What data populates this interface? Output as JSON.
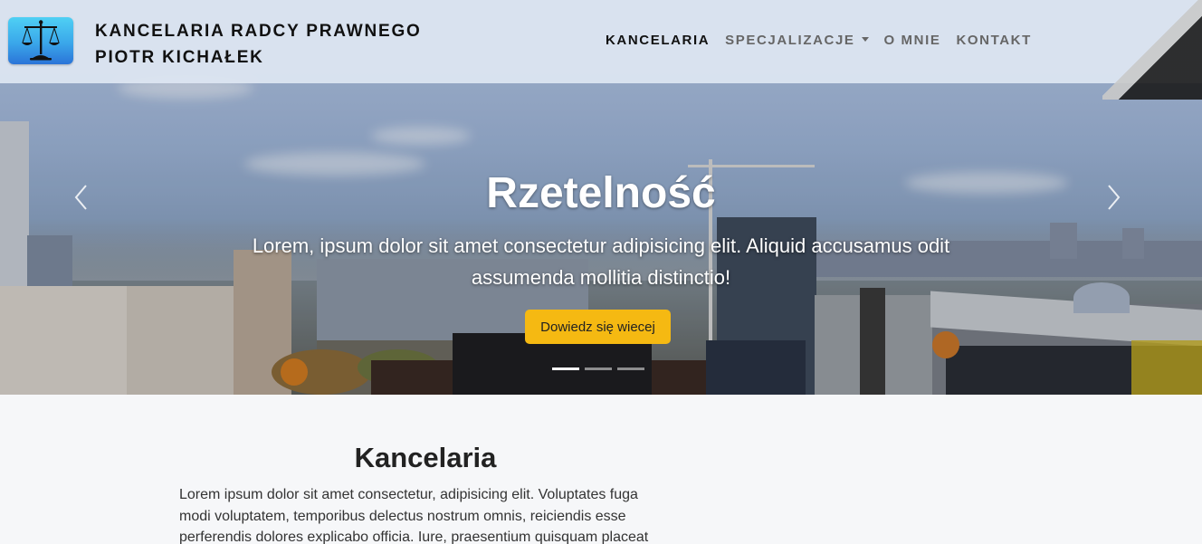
{
  "brand": {
    "line1": "KANCELARIA RADCY PRAWNEGO",
    "line2": "PIOTR KICHAŁEK",
    "logo_icon": "scales-of-justice-icon"
  },
  "nav": {
    "items": [
      {
        "label": "KANCELARIA",
        "active": true
      },
      {
        "label": "SPECJALIZACJE",
        "dropdown": true
      },
      {
        "label": "O MNIE"
      },
      {
        "label": "KONTAKT"
      }
    ]
  },
  "carousel": {
    "title": "Rzetelność",
    "text": "Lorem, ipsum dolor sit amet consectetur adipisicing elit. Aliquid accusamus odit assumenda mollitia distinctio!",
    "cta_label": "Dowiedz się wiecej",
    "slides_count": 3,
    "active_slide": 1,
    "prev_icon": "chevron-left-icon",
    "next_icon": "chevron-right-icon"
  },
  "section": {
    "title": "Kancelaria",
    "text": "Lorem ipsum dolor sit amet consectetur, adipisicing elit. Voluptates fuga modi voluptatem, temporibus delectus nostrum omnis, reiciendis esse perferendis dolores explicabo officia. Iure, praesentium quisquam placeat"
  },
  "colors": {
    "accent": "#f5b912",
    "navbar_bg": "#dee6f2",
    "page_bg": "#f6f7f9"
  }
}
